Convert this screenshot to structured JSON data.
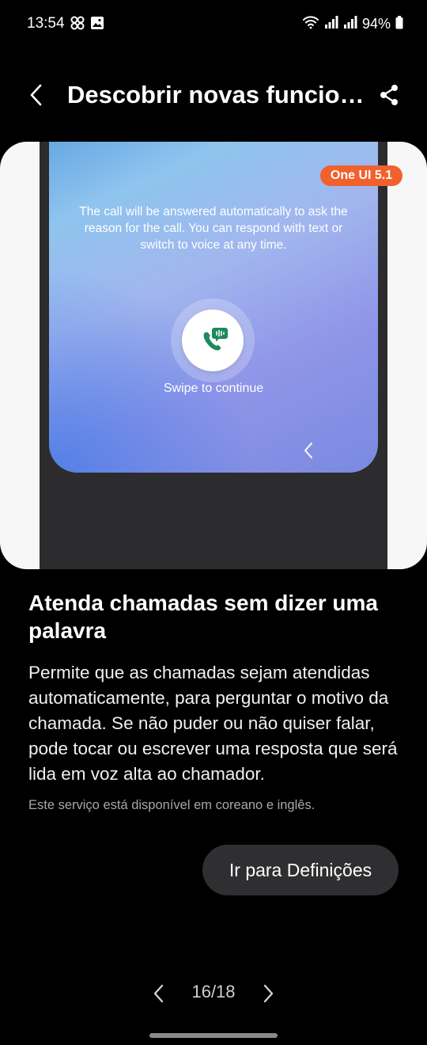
{
  "status_bar": {
    "time": "13:54",
    "battery": "94%",
    "left_icons": [
      "pinwheel-icon",
      "image-icon"
    ],
    "right_icons": [
      "wifi-icon",
      "signal-icon",
      "signal-icon",
      "battery-icon"
    ]
  },
  "header": {
    "title": "Descobrir novas funcion...",
    "back_icon": "chevron-left-icon",
    "share_icon": "share-icon"
  },
  "preview": {
    "badge": "One UI 5.1",
    "badge_color": "#f0612d",
    "description": "The call will be answered automatically to ask the reason for the call. You can respond with text or switch to voice at any time.",
    "swipe_label": "Swipe to continue",
    "call_icon": "phone-chat-icon",
    "accent_color": "#1d8a5c"
  },
  "content": {
    "heading": "Atenda chamadas sem dizer uma palavra",
    "body": "Permite que as chamadas sejam atendidas automaticamente, para perguntar o motivo da chamada. Se não puder ou não quiser falar, pode tocar ou escrever uma resposta que será lida em voz alta ao chamador.",
    "note": "Este serviço está disponível em coreano e inglês.",
    "settings_button": "Ir para Definições"
  },
  "pager": {
    "count": "16/18",
    "prev_icon": "chevron-left-icon",
    "next_icon": "chevron-right-icon"
  }
}
